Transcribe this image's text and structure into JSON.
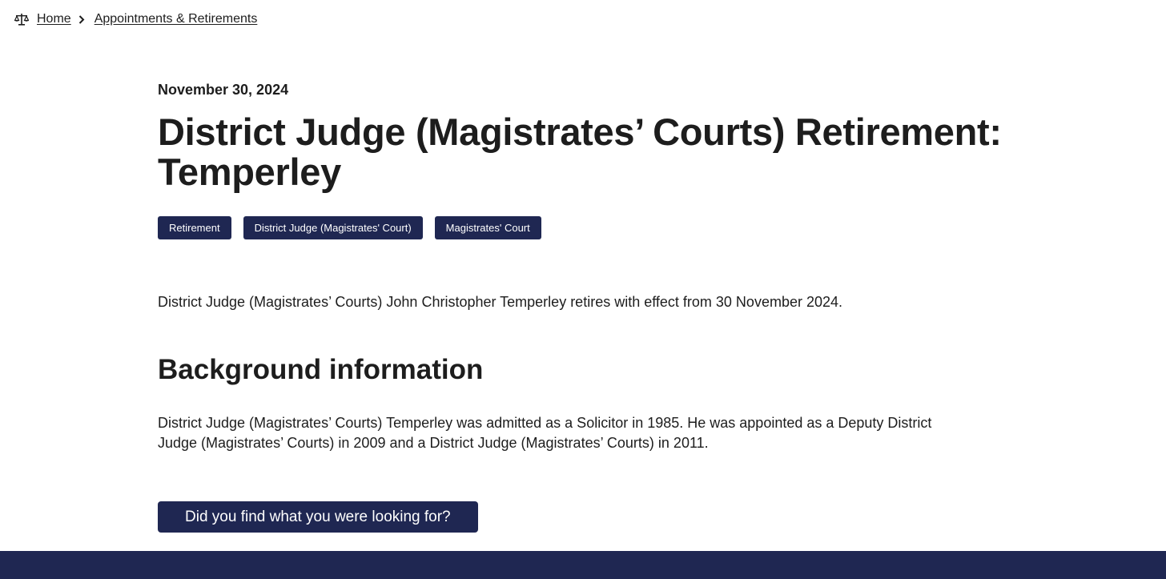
{
  "breadcrumb": {
    "icon": "scales-of-justice-icon",
    "home_label": "Home",
    "separator_icon": "chevron-right-icon",
    "current_label": "Appointments & Retirements"
  },
  "article": {
    "date": "November 30, 2024",
    "title": "District Judge (Magistrates’ Courts) Retirement: Temperley",
    "tags": [
      "Retirement",
      "District Judge (Magistrates' Court)",
      "Magistrates' Court"
    ],
    "lead": "District Judge (Magistrates’ Courts) John Christopher Temperley retires with effect from 30 November 2024.",
    "section_heading": "Background information",
    "body": "District Judge (Magistrates’ Courts) Temperley was admitted as a Solicitor in 1985. He was appointed as a Deputy District Judge (Magistrates’ Courts) in 2009 and a District Judge (Magistrates’ Courts) in 2011."
  },
  "feedback": {
    "button_label": "Did you find what you were looking for?"
  },
  "colors": {
    "brand_navy": "#1f2752",
    "text": "#1d1d1d",
    "background": "#ffffff"
  }
}
